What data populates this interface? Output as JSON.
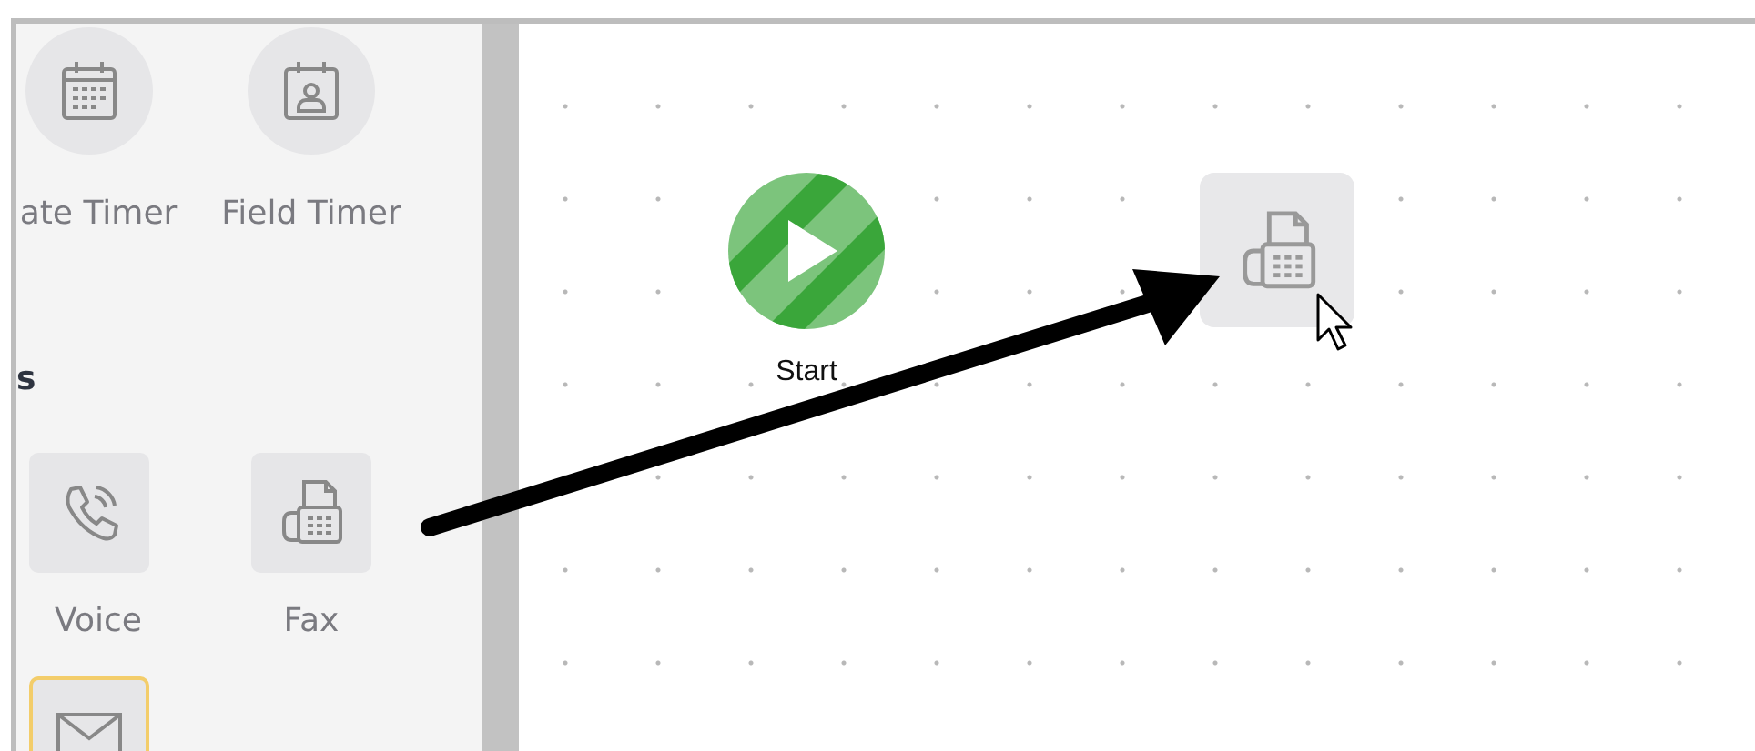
{
  "palette": {
    "timer_items": [
      {
        "kind": "date-timer",
        "label": "ate Timer"
      },
      {
        "kind": "field-timer",
        "label": "Field Timer"
      }
    ],
    "section_heading": "s",
    "items": [
      {
        "kind": "voice",
        "label": "Voice",
        "selected": false
      },
      {
        "kind": "fax",
        "label": "Fax",
        "selected": false
      },
      {
        "kind": "email",
        "selected": true
      }
    ]
  },
  "canvas": {
    "nodes": [
      {
        "kind": "start",
        "label": "Start"
      },
      {
        "kind": "fax"
      }
    ]
  }
}
